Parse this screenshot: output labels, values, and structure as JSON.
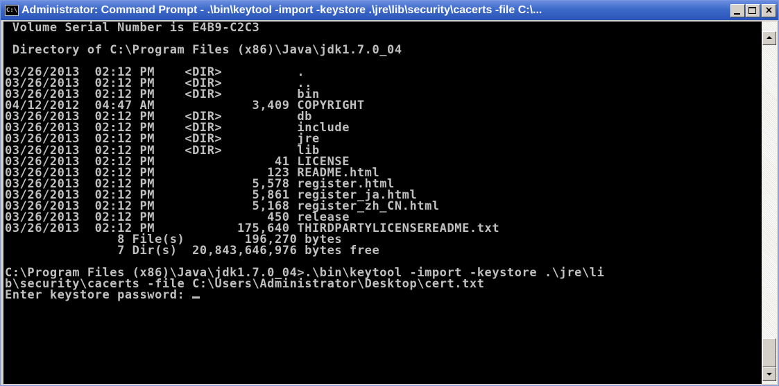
{
  "window": {
    "title": "Administrator: Command Prompt - .\\bin\\keytool  -import -keystore .\\jre\\lib\\security\\cacerts -file C:\\...",
    "icon_text": "C:\\",
    "buttons": {
      "minimize": "minimize",
      "maximize": "maximize",
      "close": "×"
    }
  },
  "console": {
    "lines": [
      " Volume Serial Number is E4B9-C2C3",
      "",
      " Directory of C:\\Program Files (x86)\\Java\\jdk1.7.0_04",
      "",
      "03/26/2013  02:12 PM    <DIR>          .",
      "03/26/2013  02:12 PM    <DIR>          ..",
      "03/26/2013  02:12 PM    <DIR>          bin",
      "04/12/2012  04:47 AM             3,409 COPYRIGHT",
      "03/26/2013  02:12 PM    <DIR>          db",
      "03/26/2013  02:12 PM    <DIR>          include",
      "03/26/2013  02:12 PM    <DIR>          jre",
      "03/26/2013  02:12 PM    <DIR>          lib",
      "03/26/2013  02:12 PM                41 LICENSE",
      "03/26/2013  02:12 PM               123 README.html",
      "03/26/2013  02:12 PM             5,578 register.html",
      "03/26/2013  02:12 PM             5,861 register_ja.html",
      "03/26/2013  02:12 PM             5,168 register_zh_CN.html",
      "03/26/2013  02:12 PM               450 release",
      "03/26/2013  02:12 PM           175,640 THIRDPARTYLICENSEREADME.txt",
      "               8 File(s)        196,270 bytes",
      "               7 Dir(s)  20,843,646,976 bytes free",
      "",
      "C:\\Program Files (x86)\\Java\\jdk1.7.0_04>.\\bin\\keytool -import -keystore .\\jre\\li",
      "b\\security\\cacerts -file C:\\Users\\Administrator\\Desktop\\cert.txt"
    ],
    "prompt": "Enter keystore password: "
  },
  "colors": {
    "console_bg": "#000000",
    "console_fg": "#c0c0c0",
    "titlebar": "#3c6ac9",
    "title_text": "#ffffff",
    "chrome": "#d4d0c8"
  }
}
